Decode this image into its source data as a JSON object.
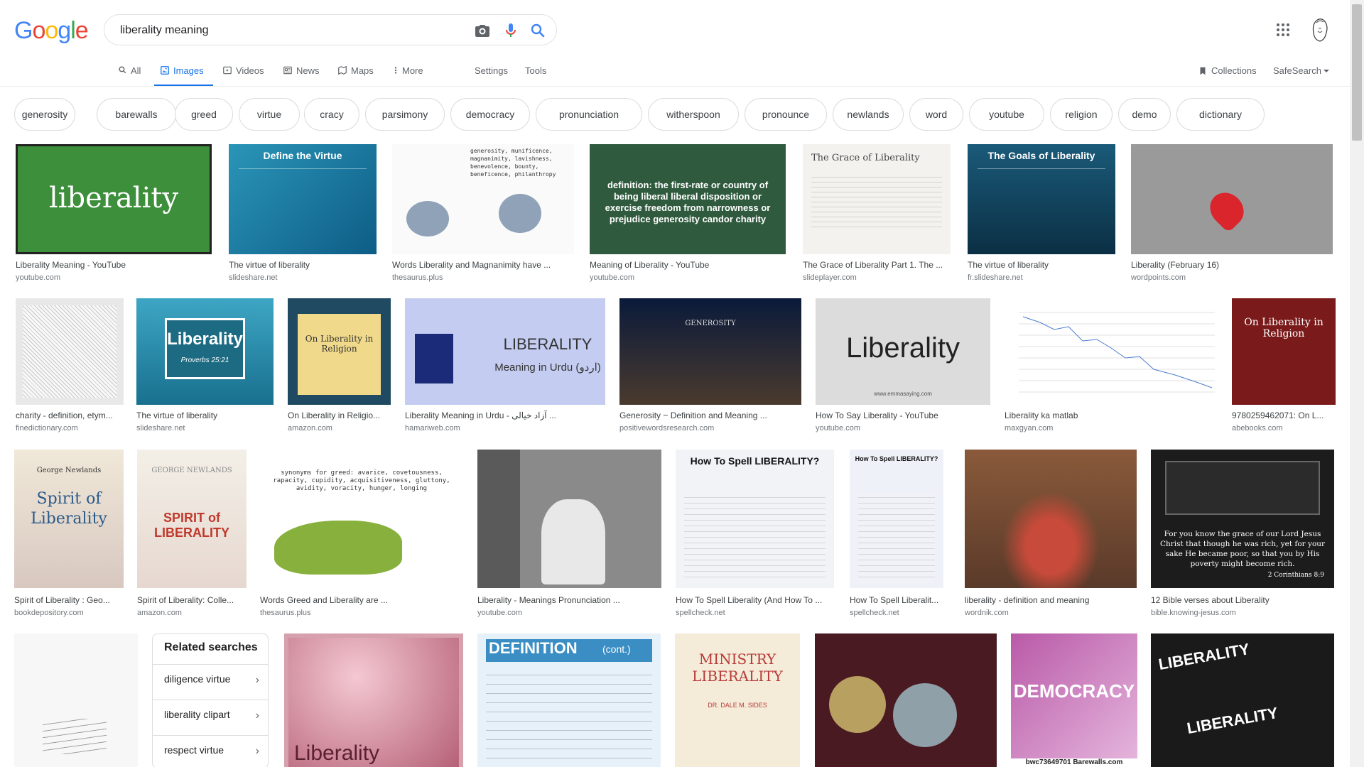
{
  "header": {
    "logo_letters": [
      {
        "ch": "G",
        "color": "#4285f4"
      },
      {
        "ch": "o",
        "color": "#ea4335"
      },
      {
        "ch": "o",
        "color": "#fbbc05"
      },
      {
        "ch": "g",
        "color": "#4285f4"
      },
      {
        "ch": "l",
        "color": "#34a853"
      },
      {
        "ch": "e",
        "color": "#ea4335"
      }
    ],
    "search_value": "liberality meaning"
  },
  "tabs": {
    "all": "All",
    "images": "Images",
    "videos": "Videos",
    "news": "News",
    "maps": "Maps",
    "more": "More",
    "settings": "Settings",
    "tools": "Tools",
    "collections": "Collections",
    "safesearch": "SafeSearch"
  },
  "chips": [
    "generosity",
    "barewalls",
    "greed",
    "virtue",
    "cracy",
    "parsimony",
    "democracy",
    "pronunciation",
    "witherspoon",
    "pronounce",
    "newlands",
    "word",
    "youtube",
    "religion",
    "demo",
    "dictionary"
  ],
  "row1": [
    {
      "caption": "Liberality Meaning - YouTube",
      "source": "youtube.com",
      "text": "liberality"
    },
    {
      "caption": "The virtue of liberality",
      "source": "slideshare.net",
      "text": "Define the Virtue"
    },
    {
      "caption": "Words Liberality and Magnanimity have ...",
      "source": "thesaurus.plus",
      "text": "generosity, munificence, magnanimity, lavishness, benevolence, bounty, beneficence, philanthropy"
    },
    {
      "caption": "Meaning of Liberality - YouTube",
      "source": "youtube.com",
      "text": "definition: the first-rate or country of being liberal liberal disposition or exercise freedom from narrowness or prejudice generosity candor charity"
    },
    {
      "caption": "The Grace of Liberality Part 1. The ...",
      "source": "slideplayer.com",
      "text": "The Grace of Liberality"
    },
    {
      "caption": "The virtue of liberality",
      "source": "fr.slideshare.net",
      "text": "The Goals of Liberality"
    },
    {
      "caption": "Liberality (February 16)",
      "source": "wordpoints.com",
      "text": ""
    }
  ],
  "row2": [
    {
      "caption": "charity - definition, etym...",
      "source": "finedictionary.com",
      "text": ""
    },
    {
      "caption": "The virtue of liberality",
      "source": "slideshare.net",
      "text": "Liberality",
      "sub": "Proverbs 25:21"
    },
    {
      "caption": "On Liberality in Religio...",
      "source": "amazon.com",
      "text": "On Liberality in Religion"
    },
    {
      "caption": "Liberality Meaning in Urdu - آزاد خیالی ...",
      "source": "hamariweb.com",
      "text": "LIBERALITY",
      "sub": "Meaning in Urdu (اردو)"
    },
    {
      "caption": "Generosity ~ Definition and Meaning ...",
      "source": "positivewordsresearch.com",
      "text": "GENEROSITY"
    },
    {
      "caption": "How To Say Liberality - YouTube",
      "source": "youtube.com",
      "text": "Liberality",
      "sub": "www.emmasaying.com"
    },
    {
      "caption": "Liberality ka matlab",
      "source": "maxgyan.com",
      "text": ""
    },
    {
      "caption": "9780259462071: On L...",
      "source": "abebooks.com",
      "text": "On Liberality in Religion"
    }
  ],
  "row3": [
    {
      "caption": "Spirit of Liberality : Geo...",
      "source": "bookdepository.com",
      "text": "Spirit of Liberality",
      "sub": "George Newlands"
    },
    {
      "caption": "Spirit of Liberality: Colle...",
      "source": "amazon.com",
      "text": "SPIRIT of LIBERALITY",
      "sub": "GEORGE NEWLANDS"
    },
    {
      "caption": "Words Greed and Liberality are ...",
      "source": "thesaurus.plus",
      "text": "synonyms for greed: avarice, covetousness, rapacity, cupidity, acquisitiveness, gluttony, avidity, voracity, hunger, longing"
    },
    {
      "caption": "Liberality - Meanings Pronunciation ...",
      "source": "youtube.com",
      "text": ""
    },
    {
      "caption": "How To Spell Liberality (And How To ...",
      "source": "spellcheck.net",
      "text": "How To Spell LIBERALITY?"
    },
    {
      "caption": "How To Spell Liberalit...",
      "source": "spellcheck.net",
      "text": "How To Spell LIBERALITY?"
    },
    {
      "caption": "liberality - definition and meaning",
      "source": "wordnik.com",
      "text": ""
    },
    {
      "caption": "12 Bible verses about Liberality",
      "source": "bible.knowing-jesus.com",
      "text": "For you know the grace of our Lord Jesus Christ that though he was rich, yet for your sake He became poor, so that you by His poverty might become rich.",
      "sub": "2 Corinthians 8:9"
    }
  ],
  "related": {
    "title": "Related searches",
    "items": [
      "diligence virtue",
      "liberality clipart",
      "respect virtue"
    ]
  },
  "row4": [
    {
      "text": "Liberality"
    },
    {
      "text": "DEFINITION",
      "sub": "(cont.)"
    },
    {
      "text": "MINISTRY LIBERALITY",
      "sub": "DR. DALE M. SIDES"
    },
    {
      "text": ""
    },
    {
      "text": "DEMOCRACY",
      "sub": "bwc73649701 Barewalls.com"
    },
    {
      "text": "LIBERALITY"
    }
  ]
}
